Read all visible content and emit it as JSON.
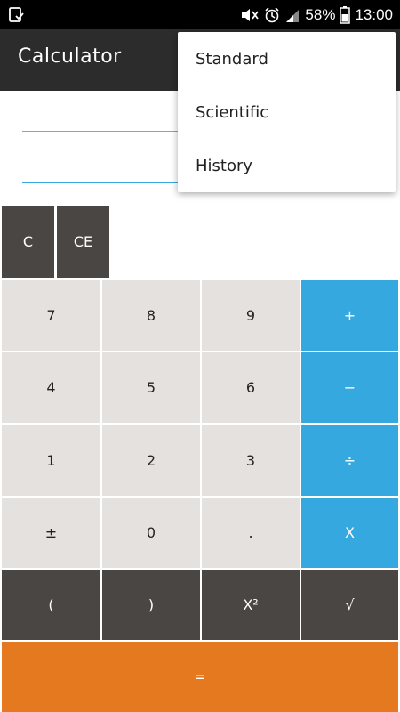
{
  "status_bar": {
    "battery_percent": "58%",
    "time": "13:00",
    "icons": [
      "download-done-icon",
      "mute-icon",
      "alarm-icon",
      "signal-icon",
      "battery-icon"
    ]
  },
  "app_bar": {
    "title": "Calculator"
  },
  "menu": {
    "items": [
      "Standard",
      "Scientific",
      "History"
    ]
  },
  "keys": {
    "clear": "C",
    "clear_entry": "CE",
    "seven": "7",
    "eight": "8",
    "nine": "9",
    "plus": "+",
    "four": "4",
    "five": "5",
    "six": "6",
    "minus": "−",
    "one": "1",
    "two": "2",
    "three": "3",
    "divide": "÷",
    "plus_minus": "±",
    "zero": "0",
    "decimal": ".",
    "multiply": "X",
    "open_paren": "(",
    "close_paren": ")",
    "square": "X²",
    "sqrt": "√",
    "equals": "="
  },
  "colors": {
    "app_bar": "#2c2c2c",
    "dark_key": "#4a4644",
    "light_key": "#e5e1df",
    "operator_key": "#35a8e0",
    "equals_key": "#e57920",
    "input_underline_active": "#3aa6e0"
  }
}
